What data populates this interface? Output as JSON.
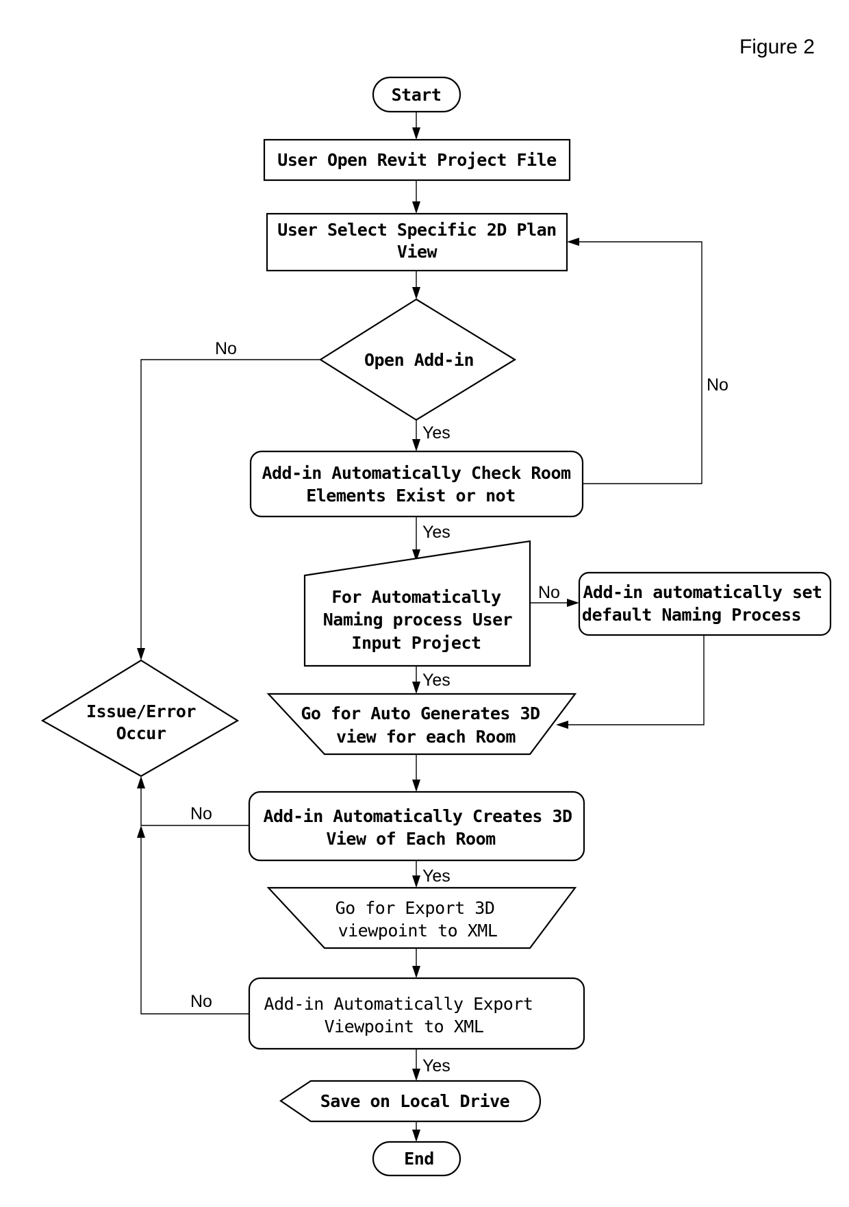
{
  "figure_label": "Figure 2",
  "nodes": {
    "start": {
      "type": "terminator",
      "lines": [
        "Start"
      ]
    },
    "open_project": {
      "type": "process",
      "lines": [
        "User Open Revit Project File"
      ]
    },
    "select_view": {
      "type": "process",
      "lines": [
        "User Select Specific 2D Plan",
        "View"
      ]
    },
    "open_addin": {
      "type": "decision",
      "lines": [
        "Open Add-in"
      ]
    },
    "check_rooms": {
      "type": "rounded-process",
      "lines": [
        "Add-in Automatically Check Room",
        "Elements Exist or not"
      ]
    },
    "naming_input": {
      "type": "manual-input",
      "lines": [
        "For Automatically",
        "Naming process User",
        "Input Project"
      ]
    },
    "default_naming": {
      "type": "rounded-process",
      "lines": [
        "Add-in automatically set",
        "default Naming Process"
      ]
    },
    "auto_generate": {
      "type": "manual-operation",
      "lines": [
        "Go for Auto Generates 3D",
        "view for each Room"
      ]
    },
    "issue_error": {
      "type": "decision",
      "lines": [
        "Issue/Error",
        "Occur"
      ]
    },
    "create_3d": {
      "type": "rounded-process",
      "lines": [
        "Add-in Automatically Creates 3D",
        "View of Each Room"
      ]
    },
    "export_go": {
      "type": "manual-operation",
      "lines": [
        "Go for Export 3D",
        "viewpoint to XML"
      ]
    },
    "export_xml": {
      "type": "rounded-process",
      "lines": [
        "Add-in Automatically Export",
        "Viewpoint to XML"
      ]
    },
    "save_local": {
      "type": "display",
      "lines": [
        "Save on Local Drive"
      ]
    },
    "end": {
      "type": "terminator",
      "lines": [
        "End"
      ]
    }
  },
  "edges": [
    {
      "from": "start",
      "to": "open_project",
      "label": ""
    },
    {
      "from": "open_project",
      "to": "select_view",
      "label": ""
    },
    {
      "from": "select_view",
      "to": "open_addin",
      "label": ""
    },
    {
      "from": "open_addin",
      "to": "check_rooms",
      "label": "Yes"
    },
    {
      "from": "open_addin",
      "to": "issue_error",
      "label": "No"
    },
    {
      "from": "check_rooms",
      "to": "naming_input",
      "label": "Yes"
    },
    {
      "from": "check_rooms",
      "to": "select_view",
      "label": "No"
    },
    {
      "from": "naming_input",
      "to": "auto_generate",
      "label": "Yes"
    },
    {
      "from": "naming_input",
      "to": "default_naming",
      "label": "No"
    },
    {
      "from": "default_naming",
      "to": "auto_generate",
      "label": ""
    },
    {
      "from": "auto_generate",
      "to": "create_3d",
      "label": ""
    },
    {
      "from": "create_3d",
      "to": "export_go",
      "label": "Yes"
    },
    {
      "from": "create_3d",
      "to": "issue_error",
      "label": "No"
    },
    {
      "from": "export_go",
      "to": "export_xml",
      "label": ""
    },
    {
      "from": "export_xml",
      "to": "save_local",
      "label": "Yes"
    },
    {
      "from": "export_xml",
      "to": "issue_error",
      "label": "No"
    },
    {
      "from": "save_local",
      "to": "end",
      "label": ""
    }
  ],
  "labels": {
    "yes": "Yes",
    "no": "No"
  }
}
